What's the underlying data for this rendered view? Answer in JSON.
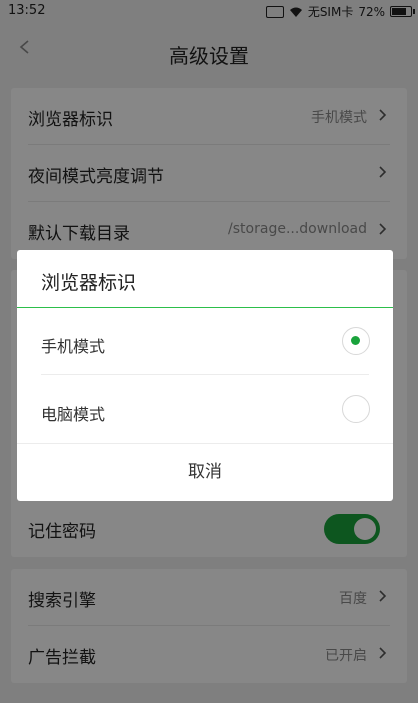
{
  "status_bar": {
    "time": "13:52",
    "carrier": "无SIM卡",
    "battery": "72%"
  },
  "watermark_link": "com",
  "app_bar": {
    "title": "高级设置",
    "back_icon": "chevron-left-icon"
  },
  "settings": {
    "group1": [
      {
        "label": "浏览器标识",
        "value": "手机模式"
      },
      {
        "label": "夜间模式亮度调节",
        "value": ""
      },
      {
        "label": "默认下载目录",
        "value": "/storage...download"
      }
    ],
    "remember_password": {
      "label": "记住密码",
      "enabled": true
    },
    "group3": [
      {
        "label": "搜索引擎",
        "value": "百度"
      },
      {
        "label": "广告拦截",
        "value": "已开启"
      }
    ]
  },
  "dialog": {
    "title": "浏览器标识",
    "options": [
      {
        "label": "手机模式",
        "selected": true
      },
      {
        "label": "电脑模式",
        "selected": false
      }
    ],
    "cancel_label": "取消",
    "accent_color": "#2cbf4a"
  },
  "colors": {
    "toggle_on": "#1aa33c",
    "radio_selected": "#1aa33c"
  }
}
